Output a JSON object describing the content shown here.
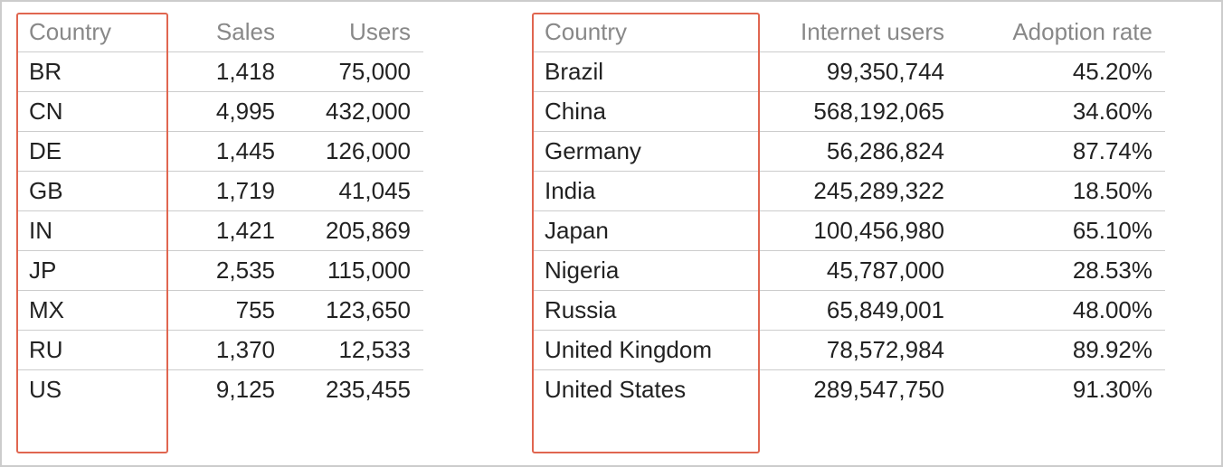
{
  "chart_data": [
    {
      "type": "table",
      "title": "",
      "columns": [
        "Country",
        "Sales",
        "Users"
      ],
      "highlight_column_index": 0,
      "rows": [
        {
          "Country": "BR",
          "Sales": "1,418",
          "Users": "75,000"
        },
        {
          "Country": "CN",
          "Sales": "4,995",
          "Users": "432,000"
        },
        {
          "Country": "DE",
          "Sales": "1,445",
          "Users": "126,000"
        },
        {
          "Country": "GB",
          "Sales": "1,719",
          "Users": "41,045"
        },
        {
          "Country": "IN",
          "Sales": "1,421",
          "Users": "205,869"
        },
        {
          "Country": "JP",
          "Sales": "2,535",
          "Users": "115,000"
        },
        {
          "Country": "MX",
          "Sales": "755",
          "Users": "123,650"
        },
        {
          "Country": "RU",
          "Sales": "1,370",
          "Users": "12,533"
        },
        {
          "Country": "US",
          "Sales": "9,125",
          "Users": "235,455"
        }
      ]
    },
    {
      "type": "table",
      "title": "",
      "columns": [
        "Country",
        "Internet users",
        "Adoption rate"
      ],
      "highlight_column_index": 0,
      "rows": [
        {
          "Country": "Brazil",
          "Internet users": "99,350,744",
          "Adoption rate": "45.20%"
        },
        {
          "Country": "China",
          "Internet users": "568,192,065",
          "Adoption rate": "34.60%"
        },
        {
          "Country": "Germany",
          "Internet users": "56,286,824",
          "Adoption rate": "87.74%"
        },
        {
          "Country": "India",
          "Internet users": "245,289,322",
          "Adoption rate": "18.50%"
        },
        {
          "Country": "Japan",
          "Internet users": "100,456,980",
          "Adoption rate": "65.10%"
        },
        {
          "Country": "Nigeria",
          "Internet users": "45,787,000",
          "Adoption rate": "28.53%"
        },
        {
          "Country": "Russia",
          "Internet users": "65,849,001",
          "Adoption rate": "48.00%"
        },
        {
          "Country": "United Kingdom",
          "Internet users": "78,572,984",
          "Adoption rate": "89.92%"
        },
        {
          "Country": "United States",
          "Internet users": "289,547,750",
          "Adoption rate": "91.30%"
        }
      ]
    }
  ],
  "colors": {
    "highlight_border": "#e06650",
    "header_text": "#888888",
    "row_border": "#cccccc"
  }
}
